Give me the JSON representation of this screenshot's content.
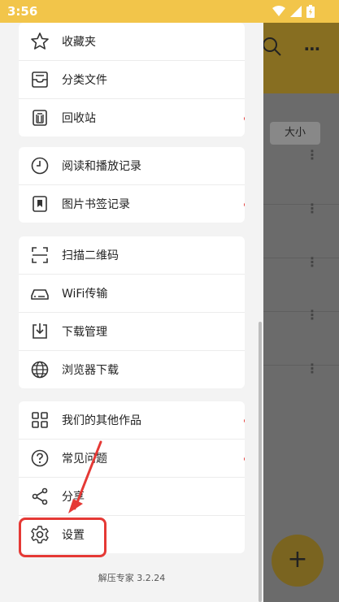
{
  "status_bar": {
    "time": "3:56",
    "icons": [
      "wifi-icon",
      "signal-icon",
      "battery-icon"
    ]
  },
  "background_app": {
    "sort_chip_label": "大小",
    "fab_label": "+"
  },
  "drawer": {
    "group1": [
      {
        "label": "收藏夹",
        "icon": "star-icon",
        "dot": false
      },
      {
        "label": "分类文件",
        "icon": "tray-icon",
        "dot": false
      },
      {
        "label": "回收站",
        "icon": "trash-icon",
        "dot": true
      }
    ],
    "group2": [
      {
        "label": "阅读和播放记录",
        "icon": "clock-icon",
        "dot": false
      },
      {
        "label": "图片书签记录",
        "icon": "bookmark-icon",
        "dot": true
      }
    ],
    "group3": [
      {
        "label": "扫描二维码",
        "icon": "scan-icon",
        "dot": false
      },
      {
        "label": "WiFi传输",
        "icon": "wifi-transfer-icon",
        "dot": false
      },
      {
        "label": "下载管理",
        "icon": "download-icon",
        "dot": false
      },
      {
        "label": "浏览器下载",
        "icon": "globe-icon",
        "dot": false
      }
    ],
    "group4": [
      {
        "label": "我们的其他作品",
        "icon": "grid-icon",
        "dot": true
      },
      {
        "label": "常见问题",
        "icon": "help-icon",
        "dot": true
      },
      {
        "label": "分享",
        "icon": "share-icon",
        "dot": false
      },
      {
        "label": "设置",
        "icon": "gear-icon",
        "dot": false
      }
    ],
    "version": "解压专家 3.2.24"
  },
  "colors": {
    "status_bar": "#f2c54a",
    "badge_dot": "#e53935",
    "annotation": "#e53935"
  }
}
